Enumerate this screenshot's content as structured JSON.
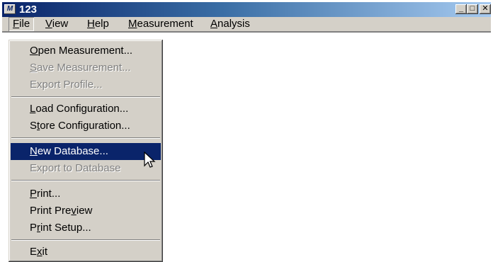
{
  "window": {
    "title": "123",
    "app_icon_text": "M"
  },
  "titlebar_buttons": {
    "minimize": "_",
    "maximize": "□",
    "close": "✕"
  },
  "menubar": {
    "items": [
      {
        "label": "File",
        "mnemonic": "F",
        "rest": "ile",
        "active": true
      },
      {
        "label": "View",
        "mnemonic": "V",
        "rest": "iew"
      },
      {
        "label": "Help",
        "mnemonic": "H",
        "rest": "elp"
      },
      {
        "label": "Measurement",
        "mnemonic": "M",
        "rest": "easurement"
      },
      {
        "label": "Analysis",
        "mnemonic": "A",
        "rest": "nalysis"
      }
    ]
  },
  "file_menu": {
    "items": [
      {
        "label": "Open Measurement...",
        "pre": "",
        "key": "O",
        "post": "pen Measurement...",
        "enabled": true
      },
      {
        "label": "Save Measurement...",
        "pre": "",
        "key": "S",
        "post": "ave Measurement...",
        "enabled": false
      },
      {
        "label": "Export Profile...",
        "pre": "Export Profile...",
        "key": "",
        "post": "",
        "enabled": false
      },
      {
        "label": "Load Configuration...",
        "pre": "",
        "key": "L",
        "post": "oad Configuration...",
        "enabled": true
      },
      {
        "label": "Store Configuration...",
        "pre": "S",
        "key": "t",
        "post": "ore Configuration...",
        "enabled": true
      },
      {
        "label": "New Database...",
        "pre": "",
        "key": "N",
        "post": "ew Database...",
        "enabled": true,
        "highlighted": true
      },
      {
        "label": "Export to Database",
        "pre": "Export to Database",
        "key": "",
        "post": "",
        "enabled": false
      },
      {
        "label": "Print...",
        "pre": "",
        "key": "P",
        "post": "rint...",
        "enabled": true
      },
      {
        "label": "Print Preview",
        "pre": "Print Pre",
        "key": "v",
        "post": "iew",
        "enabled": true
      },
      {
        "label": "Print Setup...",
        "pre": "P",
        "key": "r",
        "post": "int Setup...",
        "enabled": true
      },
      {
        "label": "Exit",
        "pre": "E",
        "key": "x",
        "post": "it",
        "enabled": true
      }
    ]
  },
  "colors": {
    "titlebar_start": "#0a246a",
    "titlebar_end": "#a6caf0",
    "menu_face": "#d4d0c8",
    "highlight": "#0a246a",
    "disabled_text": "#808080"
  }
}
